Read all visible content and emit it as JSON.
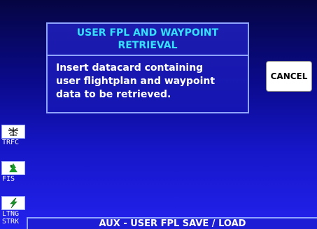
{
  "dialog": {
    "title": "USER FPL AND WAYPOINT\nRETRIEVAL",
    "message": "Insert datacard containing\nuser flightplan and waypoint\ndata to be retrieved."
  },
  "buttons": {
    "cancel_label": "CANCEL"
  },
  "sidebar": {
    "items": [
      {
        "label": "TRFC",
        "icon": "traffic-icon"
      },
      {
        "label": "FIS",
        "icon": "fis-icon"
      },
      {
        "label": "LTNG\nSTRK",
        "icon": "lightning-icon"
      }
    ]
  },
  "status_bar": {
    "title": "AUX - USER FPL SAVE / LOAD"
  },
  "colors": {
    "title_text": "#36e0ff",
    "dialog_border": "#8fa4ff",
    "background_top": "#050542",
    "background_bottom": "#2222ee"
  }
}
